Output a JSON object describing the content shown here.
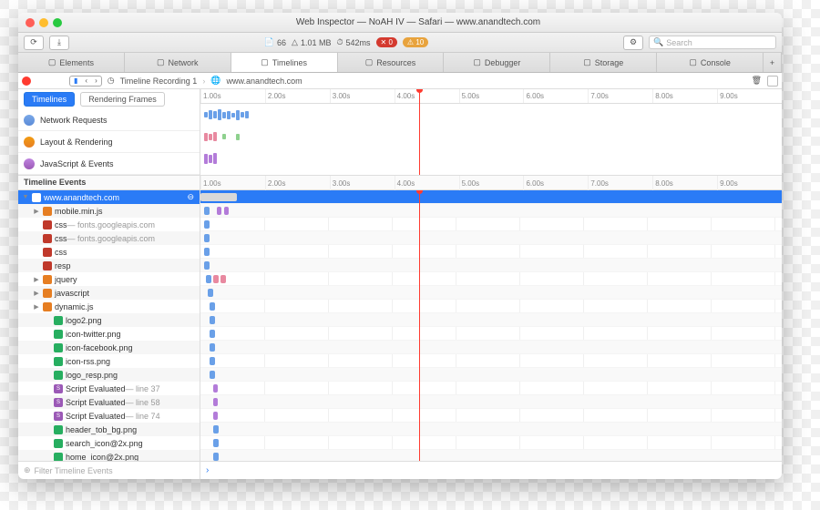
{
  "window": {
    "title": "Web Inspector — NoAH IV — Safari — www.anandtech.com"
  },
  "status": {
    "docs": "66",
    "size": "1.01 MB",
    "time": "542ms",
    "errors": "0",
    "warnings": "10",
    "search_placeholder": "Search"
  },
  "tabs": [
    {
      "label": "Elements"
    },
    {
      "label": "Network"
    },
    {
      "label": "Timelines"
    },
    {
      "label": "Resources"
    },
    {
      "label": "Debugger"
    },
    {
      "label": "Storage"
    },
    {
      "label": "Console"
    }
  ],
  "path": {
    "recording": "Timeline Recording 1",
    "site": "www.anandtech.com"
  },
  "segments": {
    "a": "Timelines",
    "b": "Rendering Frames"
  },
  "overview": [
    {
      "label": "Network Requests",
      "color": "linear-gradient(#7aa8e8,#5b8bd8)"
    },
    {
      "label": "Layout & Rendering",
      "color": "linear-gradient(#f39c12,#e67e22)"
    },
    {
      "label": "JavaScript & Events",
      "color": "linear-gradient(#c084e0,#9b59b6)"
    }
  ],
  "ruler": [
    "1.00s",
    "2.00s",
    "3.00s",
    "4.00s",
    "5.00s",
    "6.00s",
    "7.00s",
    "8.00s",
    "9.00s"
  ],
  "events_header": "Timeline Events",
  "rows": [
    {
      "label": "www.anandtech.com",
      "disc": "▼",
      "icon": "#fff",
      "sel": true,
      "indent": 0,
      "chips": [
        {
          "l": 0,
          "w": 40,
          "c": "#d8d8d8"
        }
      ]
    },
    {
      "label": "mobile.min.js",
      "sub": "",
      "disc": "▶",
      "icon": "#e67e22",
      "indent": 1,
      "chips": [
        {
          "l": 4,
          "w": 6,
          "c": "#6aa0e8"
        },
        {
          "l": 18,
          "w": 5,
          "c": "#b37cd9"
        },
        {
          "l": 26,
          "w": 5,
          "c": "#b37cd9"
        }
      ]
    },
    {
      "label": "css",
      "sub": " — fonts.googleapis.com",
      "icon": "#c0392b",
      "indent": 1,
      "chips": [
        {
          "l": 4,
          "w": 6,
          "c": "#6aa0e8"
        }
      ]
    },
    {
      "label": "css",
      "sub": " — fonts.googleapis.com",
      "icon": "#c0392b",
      "indent": 1,
      "chips": [
        {
          "l": 4,
          "w": 6,
          "c": "#6aa0e8"
        }
      ]
    },
    {
      "label": "css",
      "icon": "#c0392b",
      "indent": 1,
      "chips": [
        {
          "l": 4,
          "w": 6,
          "c": "#6aa0e8"
        }
      ]
    },
    {
      "label": "resp",
      "icon": "#c0392b",
      "indent": 1,
      "chips": [
        {
          "l": 4,
          "w": 6,
          "c": "#6aa0e8"
        }
      ]
    },
    {
      "label": "jquery",
      "disc": "▶",
      "icon": "#e67e22",
      "indent": 1,
      "chips": [
        {
          "l": 6,
          "w": 6,
          "c": "#6aa0e8"
        },
        {
          "l": 14,
          "w": 6,
          "c": "#e889a0"
        },
        {
          "l": 22,
          "w": 6,
          "c": "#e889a0"
        }
      ]
    },
    {
      "label": "javascript",
      "disc": "▶",
      "icon": "#e67e22",
      "indent": 1,
      "chips": [
        {
          "l": 8,
          "w": 6,
          "c": "#6aa0e8"
        }
      ]
    },
    {
      "label": "dynamic.js",
      "disc": "▶",
      "icon": "#e67e22",
      "indent": 1,
      "chips": [
        {
          "l": 10,
          "w": 6,
          "c": "#6aa0e8"
        }
      ]
    },
    {
      "label": "logo2.png",
      "icon": "#27ae60",
      "indent": 2,
      "chips": [
        {
          "l": 10,
          "w": 6,
          "c": "#6aa0e8"
        }
      ]
    },
    {
      "label": "icon-twitter.png",
      "icon": "#27ae60",
      "indent": 2,
      "chips": [
        {
          "l": 10,
          "w": 6,
          "c": "#6aa0e8"
        }
      ]
    },
    {
      "label": "icon-facebook.png",
      "icon": "#27ae60",
      "indent": 2,
      "chips": [
        {
          "l": 10,
          "w": 6,
          "c": "#6aa0e8"
        }
      ]
    },
    {
      "label": "icon-rss.png",
      "icon": "#27ae60",
      "indent": 2,
      "chips": [
        {
          "l": 10,
          "w": 6,
          "c": "#6aa0e8"
        }
      ]
    },
    {
      "label": "logo_resp.png",
      "icon": "#27ae60",
      "indent": 2,
      "chips": [
        {
          "l": 10,
          "w": 6,
          "c": "#6aa0e8"
        }
      ]
    },
    {
      "label": "Script Evaluated",
      "sub": " — line 37",
      "icon": "#9b59b6",
      "code": "S",
      "indent": 2,
      "chips": [
        {
          "l": 14,
          "w": 5,
          "c": "#b37cd9"
        }
      ]
    },
    {
      "label": "Script Evaluated",
      "sub": " — line 58",
      "icon": "#9b59b6",
      "code": "S",
      "indent": 2,
      "chips": [
        {
          "l": 14,
          "w": 5,
          "c": "#b37cd9"
        }
      ]
    },
    {
      "label": "Script Evaluated",
      "sub": " — line 74",
      "icon": "#9b59b6",
      "code": "S",
      "indent": 2,
      "chips": [
        {
          "l": 14,
          "w": 5,
          "c": "#b37cd9"
        }
      ]
    },
    {
      "label": "header_tob_bg.png",
      "icon": "#27ae60",
      "indent": 2,
      "chips": [
        {
          "l": 14,
          "w": 6,
          "c": "#6aa0e8"
        }
      ]
    },
    {
      "label": "search_icon@2x.png",
      "icon": "#27ae60",
      "indent": 2,
      "chips": [
        {
          "l": 14,
          "w": 6,
          "c": "#6aa0e8"
        }
      ]
    },
    {
      "label": "home_icon@2x.png",
      "icon": "#27ae60",
      "indent": 2,
      "chips": [
        {
          "l": 14,
          "w": 6,
          "c": "#6aa0e8"
        }
      ]
    }
  ],
  "filter_placeholder": "Filter Timeline Events",
  "colors": {
    "close": "#ff5f57",
    "min": "#ffbd2e",
    "max": "#28c940"
  }
}
